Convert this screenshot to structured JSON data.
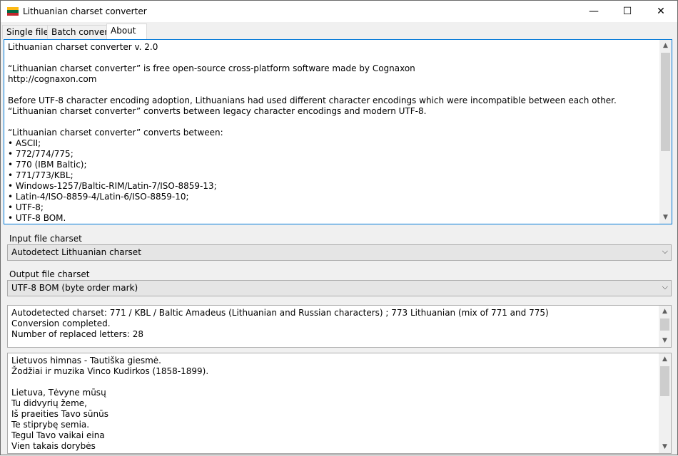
{
  "window": {
    "title": "Lithuanian charset converter",
    "flag_colors": [
      "#fdb913",
      "#006a44",
      "#c1272d"
    ]
  },
  "tabs": [
    {
      "label": "Single file"
    },
    {
      "label": "Batch convert"
    },
    {
      "label": "About",
      "selected": true
    }
  ],
  "about": {
    "lines": [
      "Lithuanian charset converter v. 2.0",
      "",
      "“Lithuanian charset converter” is free open-source cross-platform software made by Cognaxon",
      "http://cognaxon.com",
      "",
      "Before UTF-8 character encoding adoption, Lithuanians had used different character encodings which were incompatible between each other.",
      "“Lithuanian charset converter” converts between legacy character encodings and modern UTF-8.",
      "",
      "“Lithuanian charset converter” converts between:",
      "• ASCII;",
      "• 772/774/775;",
      "• 770 (IBM Baltic);",
      "• 771/773/KBL;",
      "• Windows-1257/Baltic-RIM/Latin-7/ISO-8859-13;",
      "• Latin-4/ISO-8859-4/Latin-6/ISO-8859-10;",
      "• UTF-8;",
      "• UTF-8 BOM."
    ]
  },
  "input": {
    "label": "Input file charset",
    "selected": "Autodetect Lithuanian charset"
  },
  "output": {
    "label": "Output file charset",
    "selected": "UTF-8 BOM (byte order mark)"
  },
  "status": {
    "lines": [
      "Autodetected charset: 771 / KBL / Baltic Amadeus (Lithuanian and Russian characters) ; 773 Lithuanian (mix of 771 and 775)",
      "Conversion completed.",
      "Number of replaced letters: 28"
    ]
  },
  "preview": {
    "lines": [
      "Lietuvos himnas - Tautiška giesmė.",
      "Žodžiai ir muzika Vinco Kudirkos (1858-1899).",
      "",
      "Lietuva, Tėvyne mūsų",
      "Tu didvyrių žeme,",
      "Iš praeities Tavo sūnūs",
      "Te stiprybę semia.",
      "Tegul Tavo vaikai eina",
      "Vien takais dorybės"
    ]
  },
  "icons": {
    "minimize": "—",
    "maximize": "☐",
    "close": "✕",
    "scroll_up": "▲",
    "scroll_down": "▼",
    "combo_chevron": "⌵"
  }
}
